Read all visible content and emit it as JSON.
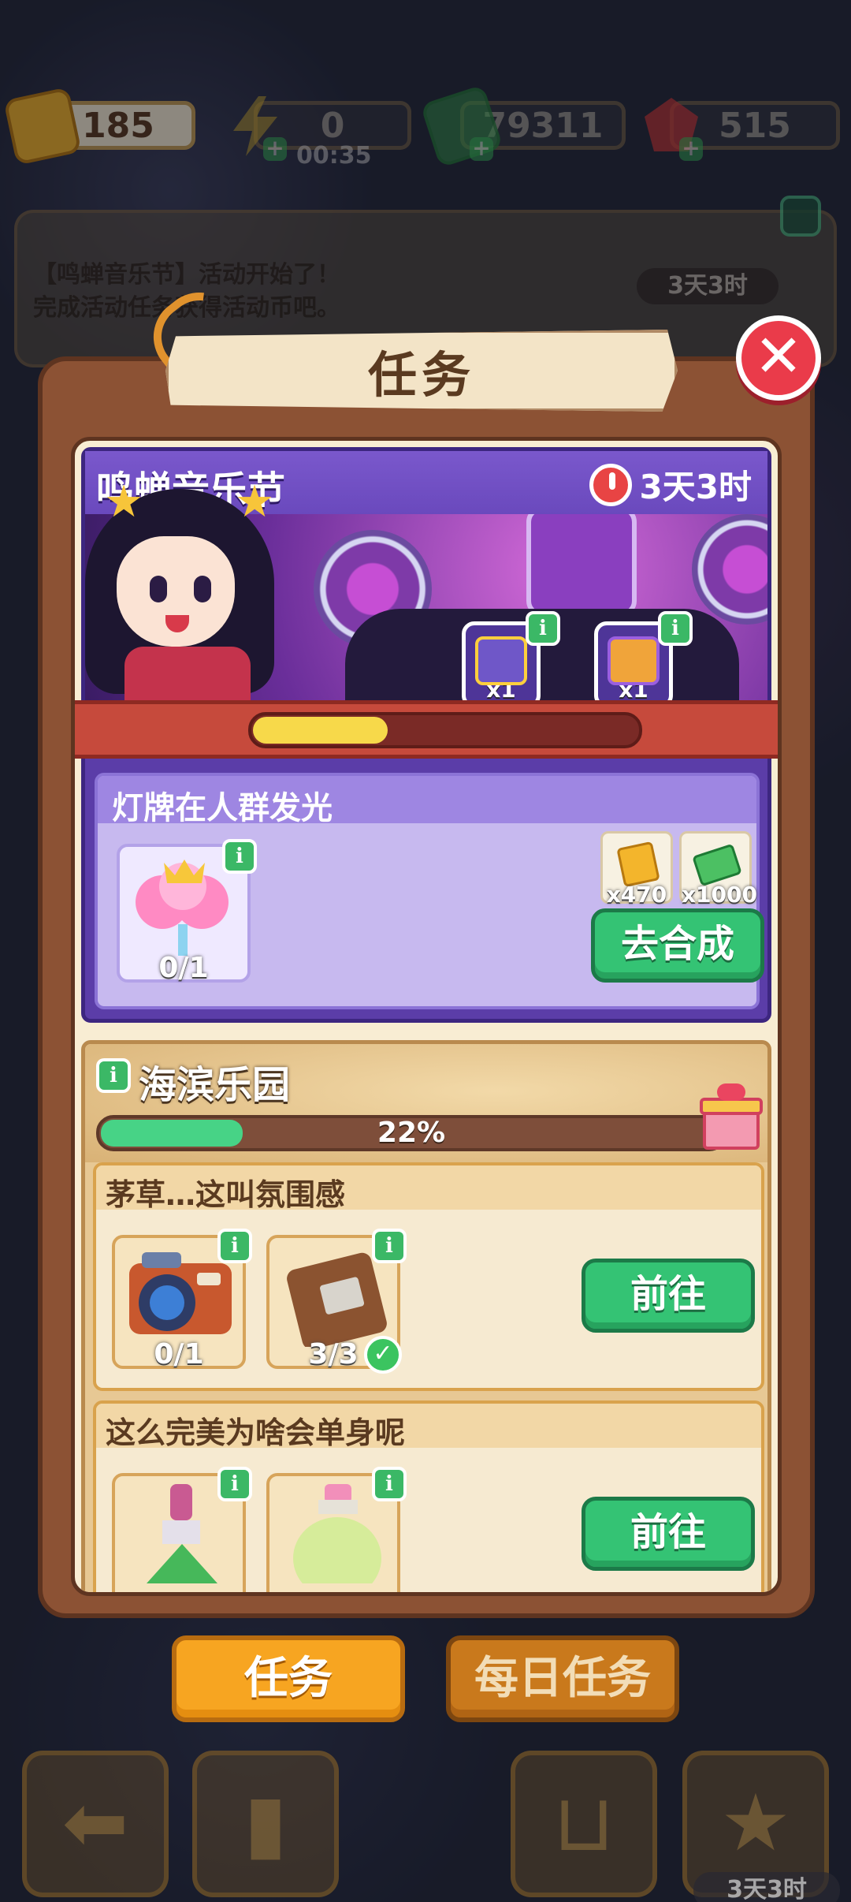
{
  "resources": [
    {
      "name": "event-ticket",
      "value": "185",
      "color": "#f3b52c"
    },
    {
      "name": "energy",
      "value": "0",
      "color": "#f7d23a"
    },
    {
      "name": "cash",
      "value": "79311",
      "color": "#3fb858"
    },
    {
      "name": "gem",
      "value": "515",
      "color": "#e23a3a"
    }
  ],
  "energy_timer": "00:35",
  "notice": {
    "line1": "【鸣蝉音乐节】活动开始了！",
    "line2": "完成活动任务获得活动币吧。",
    "timer": "3天3时"
  },
  "modal": {
    "title": "任务",
    "close_icon": "✕"
  },
  "event": {
    "title": "鸣蝉音乐节",
    "timer": "3天3时",
    "rewards": [
      {
        "icon": "music-chest-icon",
        "qty": "x1"
      },
      {
        "icon": "winged-chest-icon",
        "qty": "x1"
      }
    ],
    "progress_fraction": 0.35,
    "subtask": {
      "title": "灯牌在人群发光",
      "item_count": "0/1",
      "rewards": [
        {
          "icon": "ticket-icon",
          "qty": "x470"
        },
        {
          "icon": "cash-icon",
          "qty": "x1000"
        }
      ],
      "button": "去合成"
    }
  },
  "beach": {
    "title": "海滨乐园",
    "percent": "22%",
    "progress_fraction": 0.22,
    "tasks": [
      {
        "title": "茅草…这叫氛围感",
        "items": [
          {
            "icon": "camera-icon",
            "count": "0/1",
            "done": false
          },
          {
            "icon": "leather-bag-icon",
            "count": "3/3",
            "done": true
          }
        ],
        "button": "前往"
      },
      {
        "title": "这么完美为啥会单身呢",
        "items": [
          {
            "icon": "lipstick-icon",
            "count": "",
            "done": false
          },
          {
            "icon": "lotion-bottle-icon",
            "count": "",
            "done": false
          }
        ],
        "button": "前往"
      }
    ]
  },
  "tabs": {
    "active": "任务",
    "daily": "每日任务"
  },
  "dock": {
    "timer": "3天3时"
  },
  "info_glyph": "i",
  "check_glyph": "✓"
}
